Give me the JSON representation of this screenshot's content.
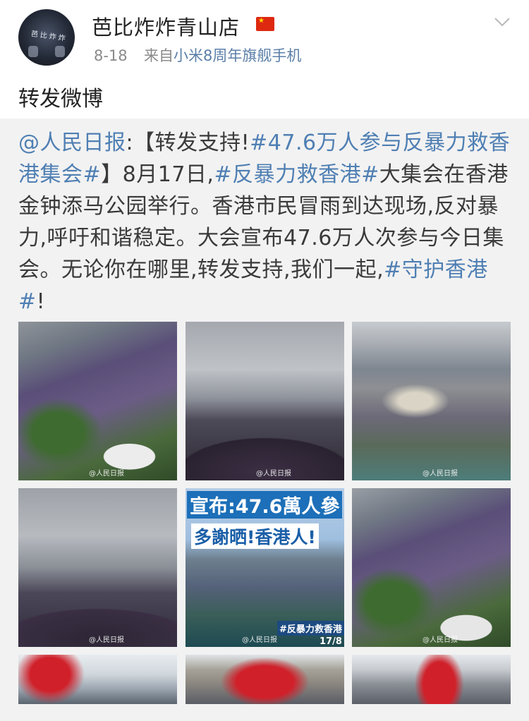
{
  "post": {
    "author": "芭比炸炸青山店",
    "avatar_text": "芭比炸炸",
    "date": "8-18",
    "from_prefix": "来自",
    "source": "小米8周年旗舰手机",
    "repost_text": "转发微博"
  },
  "quoted": {
    "segments": [
      {
        "text": "@人民日报",
        "link": true
      },
      {
        "text": ":【转发支持!",
        "link": false
      },
      {
        "text": "#47.6万人参与反暴力救香港集会#",
        "link": true
      },
      {
        "text": "】8月17日,",
        "link": false
      },
      {
        "text": "#反暴力救香港#",
        "link": true
      },
      {
        "text": "大集会在香港金钟添马公园举行。香港市民冒雨到达现场,反对暴力,呼吁和谐稳定。大会宣布47.6万人次参与今日集会。无论你在哪里,转发支持,我们一起,",
        "link": false
      },
      {
        "text": "#守护香港#",
        "link": true
      },
      {
        "text": "!",
        "link": false
      }
    ],
    "images": [
      {
        "id": "photo-1",
        "watermark": "@人民日报"
      },
      {
        "id": "photo-2",
        "watermark": "@人民日报"
      },
      {
        "id": "photo-3",
        "watermark": "@人民日报"
      },
      {
        "id": "photo-4",
        "watermark": "@人民日报"
      },
      {
        "id": "photo-5",
        "watermark": "@人民日报",
        "overlay_line1": "宣布:47.6萬人參",
        "overlay_line2": "多謝晒!香港人!",
        "overlay_tag": "#反暴力救香港",
        "overlay_date": "17/8"
      },
      {
        "id": "photo-6",
        "watermark": "@人民日报"
      },
      {
        "id": "photo-7",
        "watermark": ""
      },
      {
        "id": "photo-8",
        "watermark": ""
      },
      {
        "id": "photo-9",
        "watermark": ""
      }
    ]
  },
  "colors": {
    "link": "#4f7fb3",
    "source": "#5b7fa8",
    "quoted_bg": "#f2f2f2",
    "meta": "#8a8a8a"
  },
  "icons": [
    "china-flag-icon",
    "chevron-down-icon"
  ]
}
